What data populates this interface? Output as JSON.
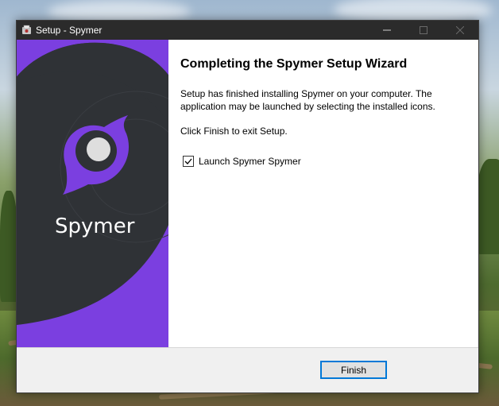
{
  "window": {
    "title": "Setup - Spymer",
    "controls": {
      "minimize_icon": "minimize-icon",
      "maximize_icon": "maximize-icon",
      "close_icon": "close-icon"
    }
  },
  "banner": {
    "brand_name": "Spymer",
    "logo_icon": "spymer-logo-icon",
    "colors": {
      "purple": "#7b3fe0",
      "dark": "#2f3236"
    }
  },
  "content": {
    "heading": "Completing the Spymer Setup Wizard",
    "paragraph1": "Setup has finished installing Spymer on your computer. The application may be launched by selecting the installed icons.",
    "paragraph2": "Click Finish to exit Setup.",
    "launch_checkbox": {
      "label": "Launch Spymer Spymer",
      "checked": true
    }
  },
  "footer": {
    "finish_label": "Finish"
  }
}
